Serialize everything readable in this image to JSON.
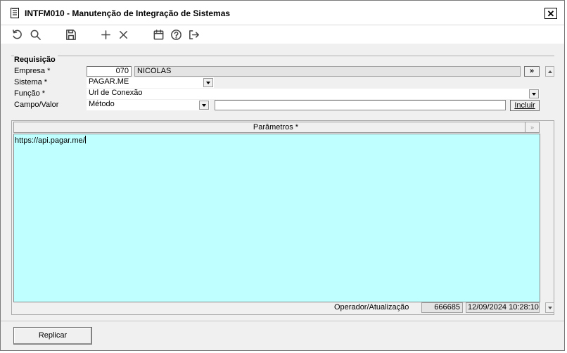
{
  "window": {
    "title": "INTFM010 - Manutenção de Integração de Sistemas"
  },
  "toolbar": {
    "icons": [
      "undo-icon",
      "search-icon",
      "save-icon",
      "add-icon",
      "delete-icon",
      "calendar-icon",
      "help-icon",
      "exit-icon"
    ]
  },
  "requisicao": {
    "section_title": "Requisição",
    "empresa": {
      "label": "Empresa *",
      "code": "070",
      "name": "NICOLAS",
      "button": "»"
    },
    "sistema": {
      "label": "Sistema *",
      "value": "PAGAR.ME"
    },
    "funcao": {
      "label": "Função *",
      "value": "Url de Conexão"
    },
    "campo_valor": {
      "label": "Campo/Valor",
      "campo": "Método",
      "valor": "",
      "button": "Incluir"
    }
  },
  "parametros": {
    "header": "Parâmetros *",
    "header_button": "»",
    "value": "https://api.pagar.me/"
  },
  "footer": {
    "operador_label": "Operador/Atualização",
    "operador": "666685",
    "atualizacao": "12/09/2024 10:28:10"
  },
  "actions": {
    "replicar": "Replicar"
  },
  "colors": {
    "params_bg": "#c0ffff",
    "window_bg": "#f0f0f0"
  }
}
